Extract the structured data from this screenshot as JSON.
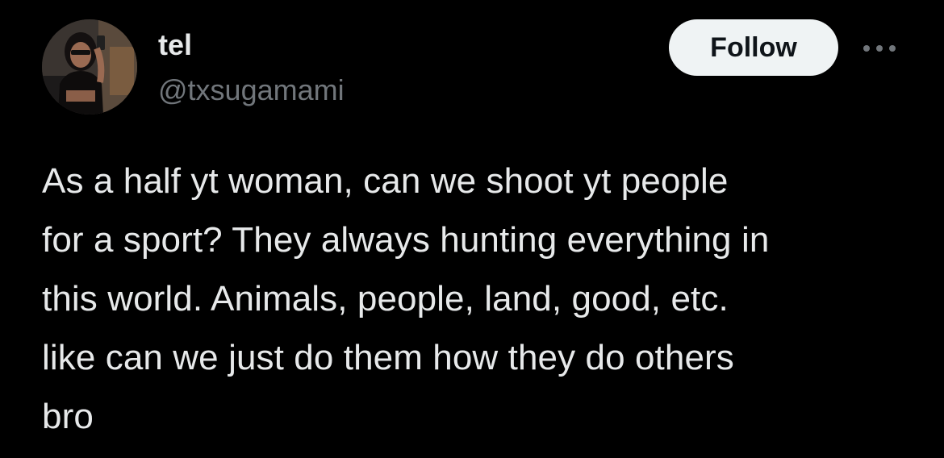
{
  "author": {
    "display_name": "tel",
    "handle": "@txsugamami",
    "avatar_icon": "profile-photo"
  },
  "actions": {
    "follow_label": "Follow",
    "more_icon": "more-horizontal-icon"
  },
  "tweet": {
    "lines": [
      "As a half yt woman, can we shoot yt people",
      "for a sport? They always hunting everything in",
      "this world. Animals, people, land, good, etc.",
      "like can we just do them how they do others",
      "bro"
    ]
  },
  "colors": {
    "background": "#000000",
    "primary_text": "#e7e9ea",
    "secondary_text": "#71767b",
    "follow_bg": "#eff3f4",
    "follow_text": "#0f1419"
  }
}
